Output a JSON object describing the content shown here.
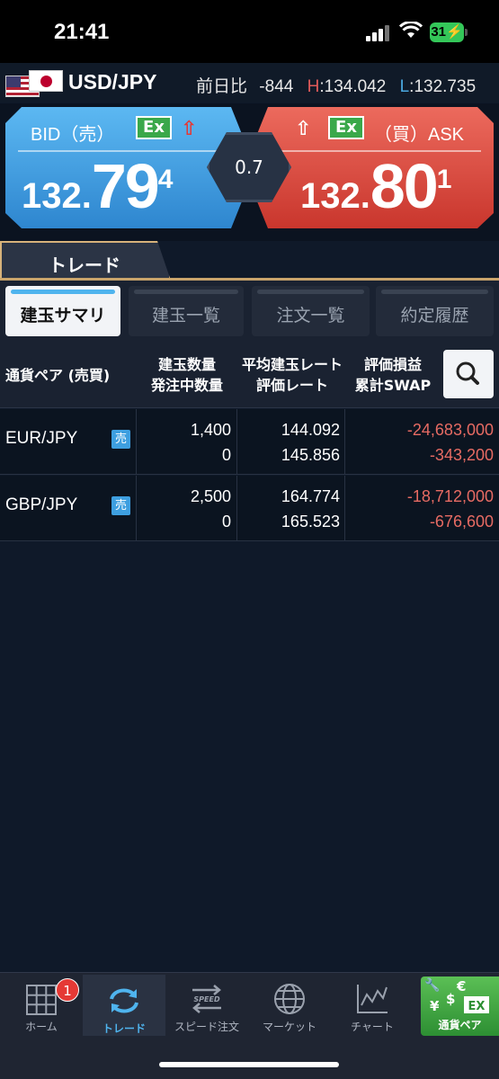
{
  "status": {
    "time": "21:41",
    "battery": "31"
  },
  "pair": {
    "name": "USD/JPY",
    "change_label": "前日比",
    "change": "-844",
    "high_label": "H",
    "high": "134.042",
    "low_label": "L",
    "low": "132.735"
  },
  "bid": {
    "label": "BID（売）",
    "ex": "Ex",
    "price_small": "132.",
    "price_big": "79",
    "price_end": "4"
  },
  "ask": {
    "label": "（買）ASK",
    "ex": "Ex",
    "price_small": "132.",
    "price_big": "80",
    "price_end": "1"
  },
  "spread": "0.7",
  "trade_tab": "トレード",
  "subtabs": [
    "建玉サマリ",
    "建玉一覧",
    "注文一覧",
    "約定履歴"
  ],
  "table": {
    "headers": {
      "pair": "通貨ペア (売買)",
      "qty1": "建玉数量",
      "qty2": "発注中数量",
      "rate1": "平均建玉レート",
      "rate2": "評価レート",
      "pl1": "評価損益",
      "pl2": "累計SWAP"
    },
    "rows": [
      {
        "pair": "EUR/JPY",
        "side": "売",
        "qty": "1,400",
        "pending": "0",
        "avg_rate": "144.092",
        "eval_rate": "145.856",
        "pl": "-24,683,000",
        "swap": "-343,200"
      },
      {
        "pair": "GBP/JPY",
        "side": "売",
        "qty": "2,500",
        "pending": "0",
        "avg_rate": "164.774",
        "eval_rate": "165.523",
        "pl": "-18,712,000",
        "swap": "-676,600"
      }
    ]
  },
  "tabbar": {
    "home": "ホーム",
    "home_badge": "1",
    "trade": "トレード",
    "speed": "スピード注文",
    "speed_icon_text": "SPEED",
    "market": "マーケット",
    "chart": "チャート",
    "pairs": "通貨ペア",
    "pairs_icon": "EX"
  },
  "colors": {
    "bid": "#3a98de",
    "ask": "#dc4a3f",
    "negative": "#e76b63",
    "accent": "#4fb4ee"
  }
}
